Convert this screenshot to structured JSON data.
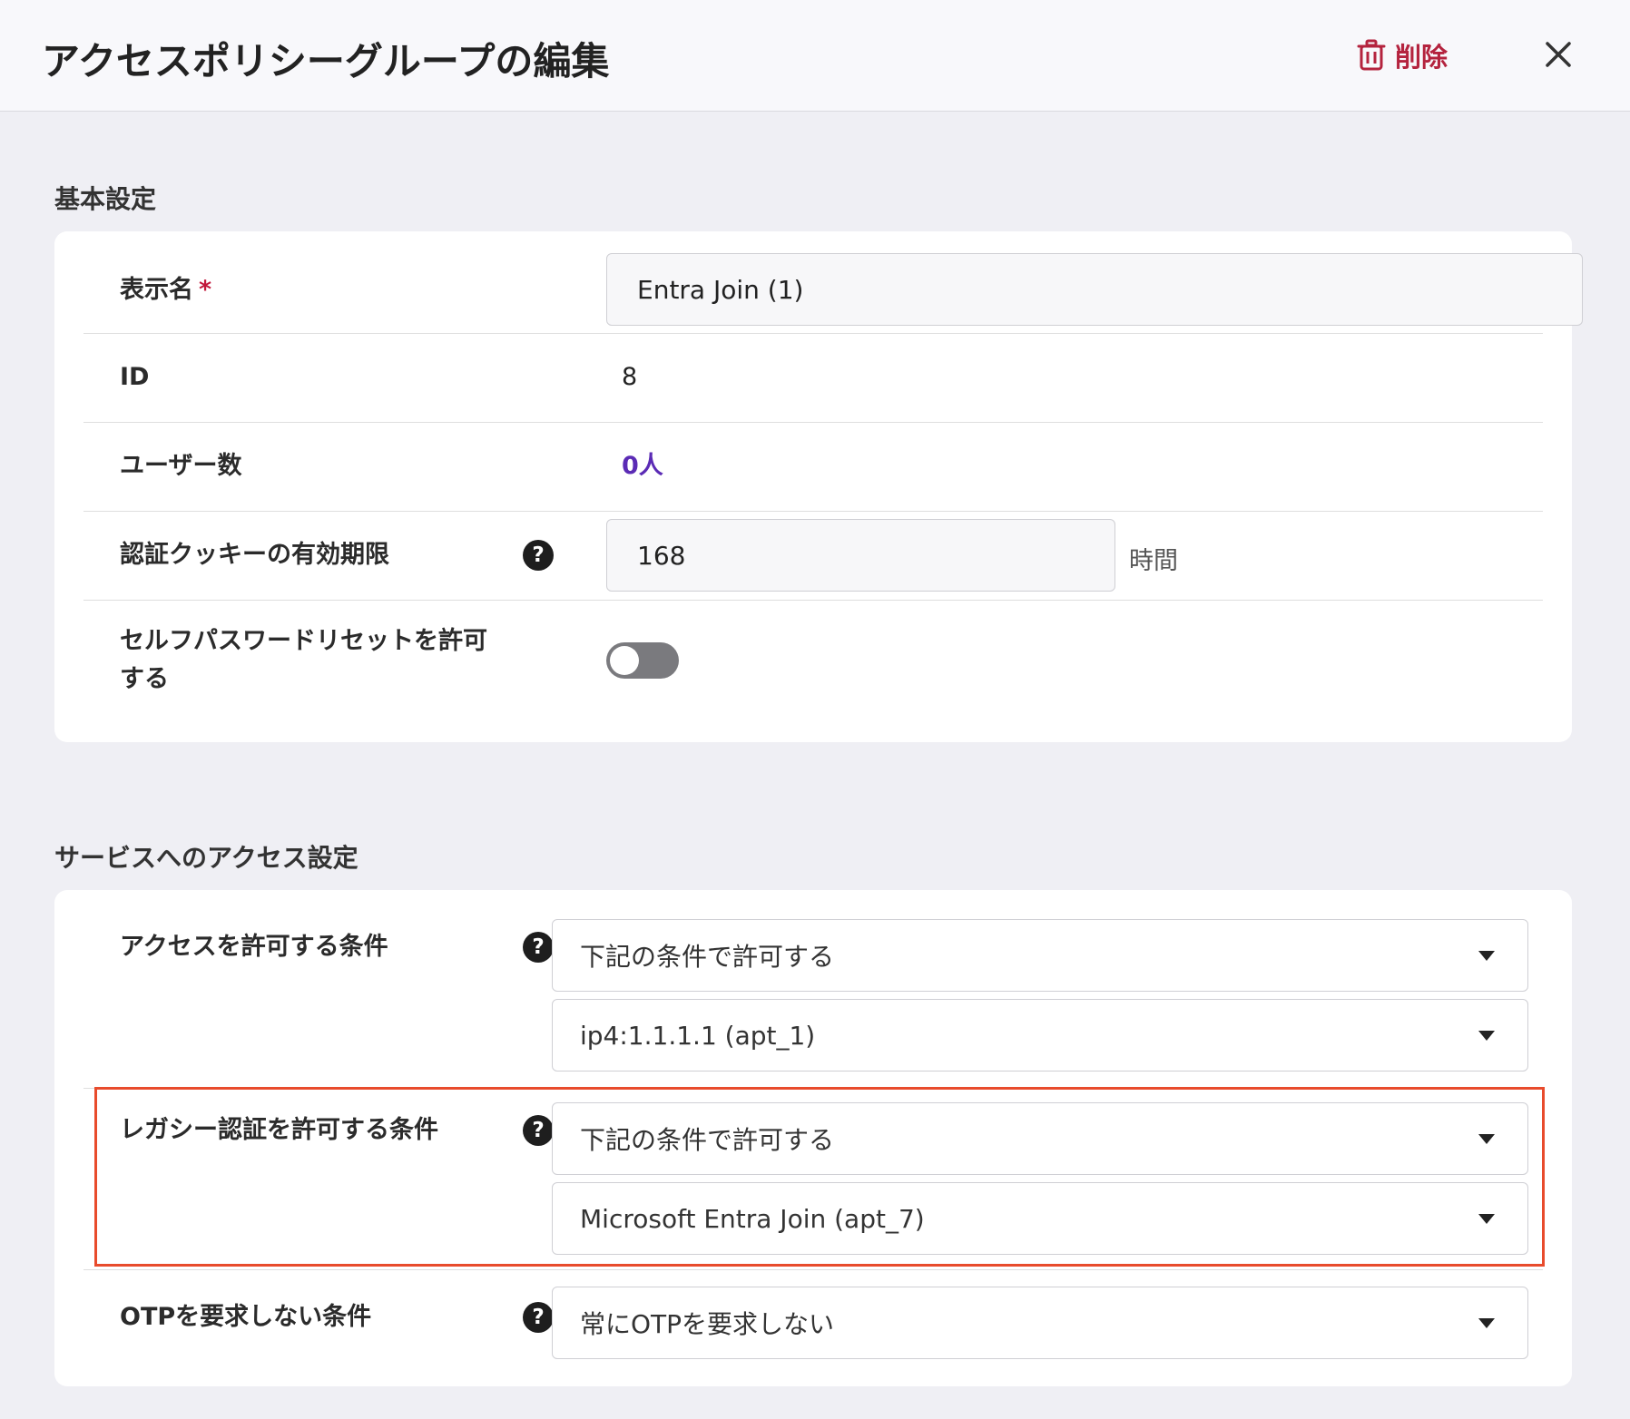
{
  "header": {
    "title": "アクセスポリシーグループの編集",
    "delete_label": "削除",
    "delete_color": "#b4233e"
  },
  "basic": {
    "section_title": "基本設定",
    "display_name": {
      "label": "表示名",
      "required_mark": "*",
      "value": "Entra Join (1)"
    },
    "id": {
      "label": "ID",
      "value": "8"
    },
    "users": {
      "label": "ユーザー数",
      "value": "0人"
    },
    "cookie": {
      "label": "認証クッキーの有効期限",
      "value": "168",
      "unit": "時間",
      "help": "?"
    },
    "self_reset": {
      "label_line1": "セルフパスワードリセットを許可",
      "label_line2": "する",
      "enabled": false
    }
  },
  "service": {
    "section_title": "サービスへのアクセス設定",
    "access": {
      "label": "アクセスを許可する条件",
      "help": "?",
      "select1": "下記の条件で許可する",
      "select2": "ip4:1.1.1.1 (apt_1)"
    },
    "legacy": {
      "label": "レガシー認証を許可する条件",
      "help": "?",
      "select1": "下記の条件で許可する",
      "select2": "Microsoft Entra Join (apt_7)",
      "highlight_color": "#e84b2c"
    },
    "otp": {
      "label": "OTPを要求しない条件",
      "help": "?",
      "select1": "常にOTPを要求しない"
    }
  }
}
